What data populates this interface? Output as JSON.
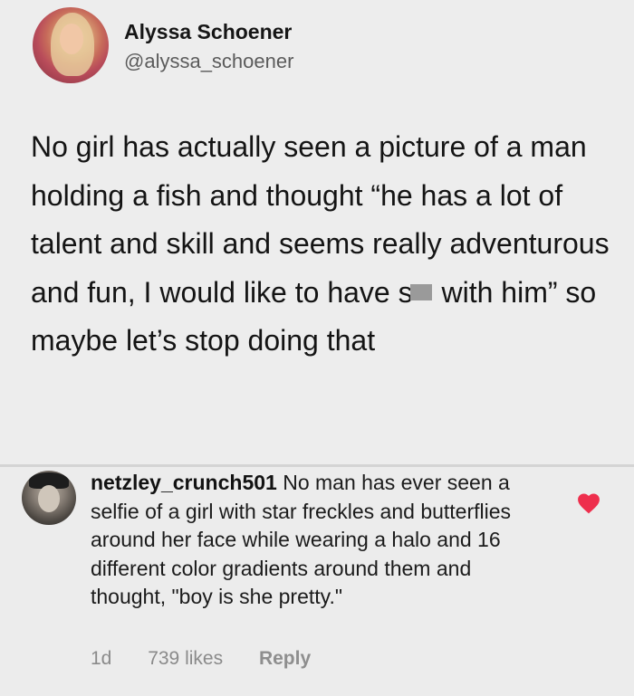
{
  "tweet": {
    "author_name": "Alyssa Schoener",
    "author_handle": "@alyssa_schoener",
    "text_before_censor": "No girl has actually seen a picture of a man holding a fish and thought “he has a lot of talent and skill and seems really adventurous and fun, I would like to have s",
    "text_after_censor": " with him” so maybe let’s stop doing that"
  },
  "comment": {
    "username": "netzley_crunch501",
    "text": " No man has ever seen a selfie of a girl with star freckles and butterflies around her face while wearing a halo and 16 different color gradients around them and thought, \"boy is she pretty.\"",
    "age": "1d",
    "likes": "739 likes",
    "reply_label": "Reply",
    "liked": true
  },
  "colors": {
    "heart": "#ee2f4d",
    "background": "#ededed",
    "muted_text": "#8a8a8a"
  },
  "icons": {
    "tweet_avatar": "profile-photo",
    "comment_avatar": "profile-photo",
    "like": "heart-icon"
  }
}
